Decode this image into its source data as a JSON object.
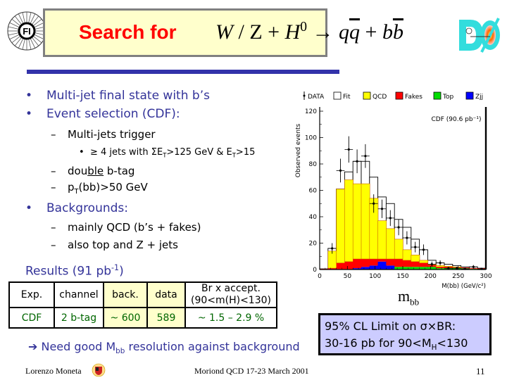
{
  "header": {
    "title_prefix": "Search for",
    "formula": {
      "W": "W",
      "slash_Z": " / Z + ",
      "H": "H",
      "H_sup": "0",
      "arrow": " → ",
      "q": "q",
      "qbar": "q",
      "plus": " + ",
      "b": "b",
      "bbar": "b"
    },
    "colors": {
      "title": "#ff0000",
      "box": "#ffffcc",
      "rule": "#3333aa"
    }
  },
  "bullets": {
    "item1": "Multi-jet final state with b’s",
    "item2": "Event selection (CDF):",
    "item2_sub1": "Multi-jets trigger",
    "item2_sub1_sub1": "≥ 4 jets with ΣE",
    "item2_sub1_sub1_T1": "T",
    "item2_sub1_sub1_mid": ">125 GeV & E",
    "item2_sub1_sub1_T2": "T",
    "item2_sub1_sub1_end": ">15",
    "item2_sub2_pre": "dou",
    "item2_sub2_ul": "ble",
    "item2_sub2_post": " b-tag",
    "item2_sub3_p": "p",
    "item2_sub3_T": "T",
    "item2_sub3_rest": "(bb)>50 GeV",
    "item3": "Backgrounds:",
    "item3_sub1": "mainly QCD (b’s + fakes)",
    "item3_sub2": "also top and Z + jets",
    "bullet_glyph": "•",
    "dash_glyph": "–"
  },
  "results": {
    "heading": "Results (91 pb",
    "heading_sup": "-1",
    "heading_close": ")",
    "table": {
      "headers": [
        "Exp.",
        "channel",
        "back.",
        "data",
        "Br x accept.",
        "(90<m(H)<130)"
      ],
      "row": [
        "CDF",
        "2 b-tag",
        "~ 600",
        "589",
        "~ 1.5 – 2.9 %"
      ]
    }
  },
  "need_line": {
    "arrow": "➔",
    "text_pre": " Need good M",
    "sub": "bb",
    "text_post": " resolution against background"
  },
  "limit_box": {
    "line1": "95% CL Limit on σ×BR:",
    "line2_pre": "30-16 pb for 90<M",
    "line2_sub": "H",
    "line2_post": "<130"
  },
  "mbb_label": {
    "main": "m",
    "sub": "bb"
  },
  "footer": {
    "author": "Lorenzo Moneta",
    "conference": "Moriond QCD 17-23 March 2001",
    "page": "11"
  },
  "chart_data": {
    "type": "bar",
    "title": "CDF (90.6 pb⁻¹)",
    "xlabel": "M(bb) (GeV/c²)",
    "ylabel": "Observed events",
    "xlim": [
      0,
      300
    ],
    "ylim": [
      0,
      120
    ],
    "xticks": [
      0,
      50,
      100,
      150,
      200,
      250,
      300
    ],
    "yticks": [
      0,
      20,
      40,
      60,
      80,
      100,
      120
    ],
    "legend": [
      "DATA",
      "Fit",
      "QCD",
      "Fakes",
      "Top",
      "Zjj"
    ],
    "legend_position": "top",
    "bin_edges": [
      0,
      15,
      30,
      45,
      60,
      75,
      90,
      105,
      120,
      135,
      150,
      165,
      180,
      195,
      210,
      225,
      240,
      255,
      270,
      285,
      300
    ],
    "series": [
      {
        "name": "Zjj",
        "color": "#0000ff",
        "values": [
          0,
          0,
          0,
          0,
          1,
          2,
          3,
          6,
          3,
          0,
          0,
          0,
          0,
          0,
          0,
          0,
          0,
          0,
          0,
          0
        ]
      },
      {
        "name": "Top",
        "color": "#00dd00",
        "values": [
          0,
          0,
          0,
          0,
          0,
          0,
          0,
          0,
          0,
          2,
          2,
          2,
          2,
          2,
          1,
          1,
          1,
          1,
          0.5,
          0.5
        ]
      },
      {
        "name": "Fakes",
        "color": "#ff0000",
        "values": [
          0.5,
          1,
          5,
          6,
          7,
          6,
          5,
          2,
          5,
          6,
          5,
          4,
          3,
          1.5,
          1,
          1,
          0.5,
          0.5,
          0.5,
          0.5
        ]
      },
      {
        "name": "QCD",
        "color": "#ffff00",
        "values": [
          0,
          13,
          56,
          62,
          57,
          57,
          46,
          29,
          23,
          15,
          8,
          5,
          2,
          0.5,
          1,
          0.5,
          0.5,
          0,
          0,
          0
        ]
      },
      {
        "name": "Fit",
        "color": "#ffffff",
        "values": [
          0.5,
          16,
          61,
          74,
          82,
          82,
          70,
          55,
          50,
          38,
          32,
          23,
          15,
          7,
          5,
          4,
          3,
          2,
          2,
          1
        ]
      }
    ],
    "data_points": {
      "x": [
        22.5,
        37.5,
        52.5,
        67.5,
        82.5,
        97.5,
        112.5,
        127.5,
        142.5,
        157.5,
        172.5,
        187.5,
        202.5,
        217.5,
        232.5,
        247.5,
        262.5,
        277.5,
        292.5
      ],
      "y": [
        16,
        75,
        91,
        82,
        86,
        50,
        46,
        39,
        32,
        24,
        17,
        15,
        4,
        5,
        1,
        1,
        0.5,
        2,
        0.5
      ],
      "yerr": [
        4,
        9,
        10,
        9,
        9,
        7,
        7,
        6,
        6,
        5,
        4,
        4,
        2,
        2,
        1,
        1,
        0.7,
        1.4,
        0.7
      ]
    },
    "annotation": "CDF (90.6 pb⁻¹)"
  }
}
